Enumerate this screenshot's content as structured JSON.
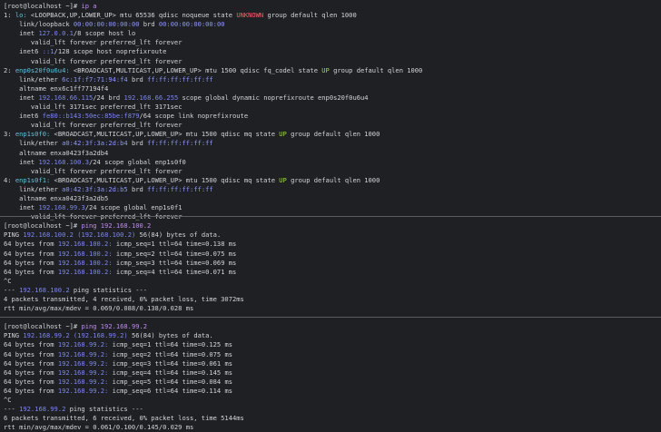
{
  "prompt": {
    "user_host": "[root@localhost ~]#",
    "cmd1": "ip a",
    "cmd2": "ping 192.168.100.2",
    "cmd3": "ping 192.168.99.2"
  },
  "ip_a": {
    "lo": {
      "index": "1:",
      "name": "lo:",
      "flags": "<LOOPBACK,UP,LOWER_UP>",
      "rest1": "mtu 65536 qdisc noqueue state",
      "state": "UNKNOWN",
      "rest2": "group default qlen 1000",
      "link_label": "link/loopback",
      "mac": "00:00:00:00:00:00",
      "brd_label": "brd",
      "brd": "00:00:00:00:00:00",
      "inet_label": "inet",
      "inet": "127.0.0.1",
      "inet_rest": "/8 scope host lo",
      "valid1": "valid_lft forever preferred_lft forever",
      "inet6_label": "inet6",
      "inet6": "::1",
      "inet6_rest": "/128 scope host noprefixroute",
      "valid2": "valid_lft forever preferred_lft forever"
    },
    "enp": {
      "index": "2:",
      "name": "enp0s20f0u6u4:",
      "flags": "<BROADCAST,MULTICAST,UP,LOWER_UP>",
      "rest1": "mtu 1500 qdisc fq_codel state",
      "state": "UP",
      "rest2": "group default qlen 1000",
      "link_label": "link/ether",
      "mac": "6c:1f:f7:71:94:f4",
      "brd_label": "brd",
      "brd": "ff:ff:ff:ff:ff:ff",
      "altname": "altname enx6c1ff77194f4",
      "inet_label": "inet",
      "inet": "192.168.66.115",
      "inet_mid": "/24 brd",
      "inet_brd": "192.168.66.255",
      "inet_rest": "scope global dynamic noprefixroute enp0s20f0u6u4",
      "valid1": "valid_lft 3171sec preferred_lft 3171sec",
      "inet6_label": "inet6",
      "inet6": "fe80::b143:50ec:85be:f879",
      "inet6_rest": "/64 scope link noprefixroute",
      "valid2": "valid_lft forever preferred_lft forever"
    },
    "enp1s0f0": {
      "index": "3:",
      "name": "enp1s0f0:",
      "flags": "<BROADCAST,MULTICAST,UP,LOWER_UP>",
      "rest1": "mtu 1500 qdisc mq state",
      "state": "UP",
      "rest2": "group default qlen 1000",
      "link_label": "link/ether",
      "mac": "a0:42:3f:3a:2d:b4",
      "brd_label": "brd",
      "brd": "ff:ff:ff:ff:ff:ff",
      "altname": "altname enxa0423f3a2db4",
      "inet_label": "inet",
      "inet": "192.168.100.3",
      "inet_rest": "/24 scope global enp1s0f0",
      "valid1": "valid_lft forever preferred_lft forever"
    },
    "enp1s0f1": {
      "index": "4:",
      "name": "enp1s0f1:",
      "flags": "<BROADCAST,MULTICAST,UP,LOWER_UP>",
      "rest1": "mtu 1500 qdisc mq state",
      "state": "UP",
      "rest2": "group default qlen 1000",
      "link_label": "link/ether",
      "mac": "a0:42:3f:3a:2d:b5",
      "brd_label": "brd",
      "brd": "ff:ff:ff:ff:ff:ff",
      "altname": "altname enxa0423f3a2db5",
      "inet_label": "inet",
      "inet": "192.168.99.3",
      "inet_rest": "/24 scope global enp1s0f1",
      "valid1": "valid_lft forever preferred_lft forever"
    }
  },
  "ping1": {
    "header_a": "PING",
    "host": "192.168.100.2",
    "host_paren": "(192.168.100.2)",
    "header_b": "56(84) bytes of data.",
    "replies": [
      {
        "pre": "64 bytes from",
        "ip": "192.168.100.2:",
        "rest": "icmp_seq=1 ttl=64 time=0.138 ms"
      },
      {
        "pre": "64 bytes from",
        "ip": "192.168.100.2:",
        "rest": "icmp_seq=2 ttl=64 time=0.075 ms"
      },
      {
        "pre": "64 bytes from",
        "ip": "192.168.100.2:",
        "rest": "icmp_seq=3 ttl=64 time=0.069 ms"
      },
      {
        "pre": "64 bytes from",
        "ip": "192.168.100.2:",
        "rest": "icmp_seq=4 ttl=64 time=0.071 ms"
      }
    ],
    "ctrl_c": "^C",
    "stats_a": "---",
    "stats_host": "192.168.100.2",
    "stats_b": "ping statistics ---",
    "summary": "4 packets transmitted, 4 received, 0% packet loss, time 3072ms",
    "rtt": "rtt min/avg/max/mdev = 0.069/0.088/0.138/0.028 ms"
  },
  "ping2": {
    "header_a": "PING",
    "host": "192.168.99.2",
    "host_paren": "(192.168.99.2)",
    "header_b": "56(84) bytes of data.",
    "replies": [
      {
        "pre": "64 bytes from",
        "ip": "192.168.99.2:",
        "rest": "icmp_seq=1 ttl=64 time=0.125 ms"
      },
      {
        "pre": "64 bytes from",
        "ip": "192.168.99.2:",
        "rest": "icmp_seq=2 ttl=64 time=0.075 ms"
      },
      {
        "pre": "64 bytes from",
        "ip": "192.168.99.2:",
        "rest": "icmp_seq=3 ttl=64 time=0.061 ms"
      },
      {
        "pre": "64 bytes from",
        "ip": "192.168.99.2:",
        "rest": "icmp_seq=4 ttl=64 time=0.145 ms"
      },
      {
        "pre": "64 bytes from",
        "ip": "192.168.99.2:",
        "rest": "icmp_seq=5 ttl=64 time=0.084 ms"
      },
      {
        "pre": "64 bytes from",
        "ip": "192.168.99.2:",
        "rest": "icmp_seq=6 ttl=64 time=0.114 ms"
      }
    ],
    "ctrl_c": "^C",
    "stats_a": "---",
    "stats_host": "192.168.99.2",
    "stats_b": "ping statistics ---",
    "summary": "6 packets transmitted, 6 received, 0% packet loss, time 5144ms",
    "rtt": "rtt min/avg/max/mdev = 0.061/0.100/0.145/0.029 ms"
  },
  "colors": {
    "background": "#1f2024",
    "text": "#d2d4d8",
    "interface_name": "#62c0d8",
    "state_up": "#9bd54a",
    "state_unknown": "#ff5f6a",
    "address": "#7d86f2"
  }
}
